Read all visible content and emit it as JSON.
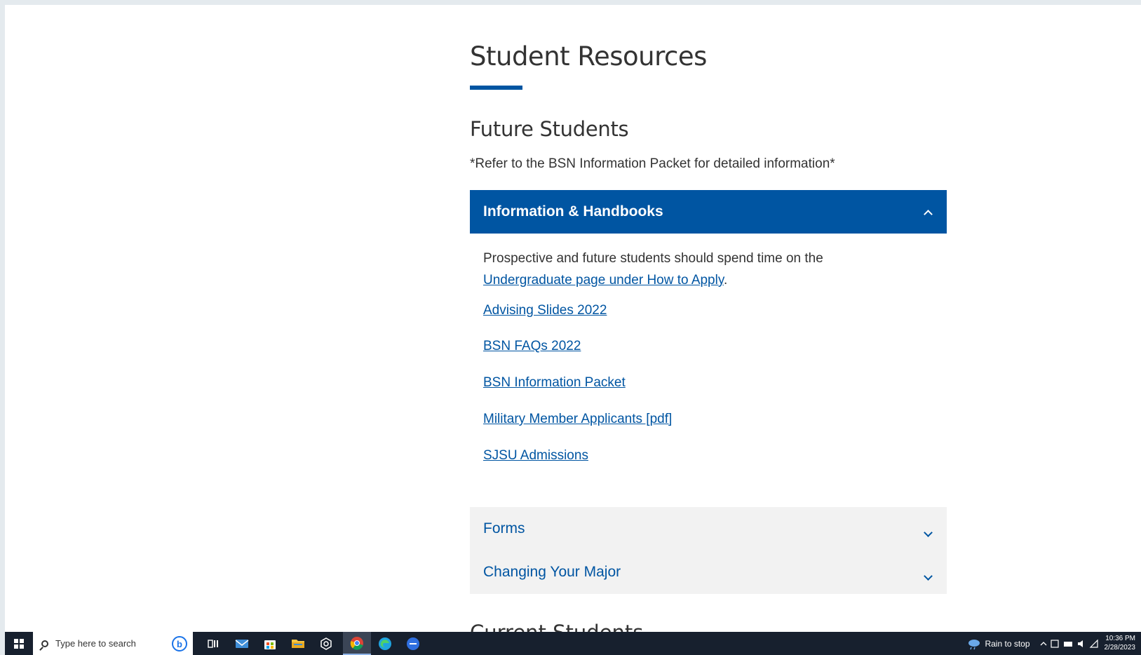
{
  "page": {
    "title": "Student Resources",
    "section_heading": "Future Students",
    "note": "*Refer to the BSN Information Packet for detailed information*",
    "next_section_heading": "Current Students"
  },
  "accordion": {
    "open": {
      "label": "Information & Handbooks",
      "intro_text": "Prospective and future students should spend time on the ",
      "intro_link": "Undergraduate page under How to Apply",
      "intro_end": ".",
      "links": [
        "Advising Slides 2022",
        "BSN FAQs 2022",
        "BSN Information Packet",
        "Military Member Applicants [pdf]",
        "SJSU Admissions"
      ]
    },
    "forms_label": "Forms",
    "major_label": "Changing Your Major"
  },
  "taskbar": {
    "search_placeholder": "Type here to search",
    "weather": "Rain to stop",
    "time": "10:36 PM",
    "date": "2/28/2023"
  },
  "colors": {
    "brand_blue": "#0055a2",
    "accordion_closed_bg": "#f2f2f2",
    "taskbar_bg": "#17202e"
  },
  "icons": [
    "start-icon",
    "search-icon",
    "bing-icon",
    "task-view-icon",
    "mail-icon",
    "store-icon",
    "file-explorer-icon",
    "settings-icon",
    "chrome-icon",
    "edge-icon",
    "chat-icon",
    "weather-icon",
    "chevron-up-icon",
    "chevron-down-icon"
  ]
}
